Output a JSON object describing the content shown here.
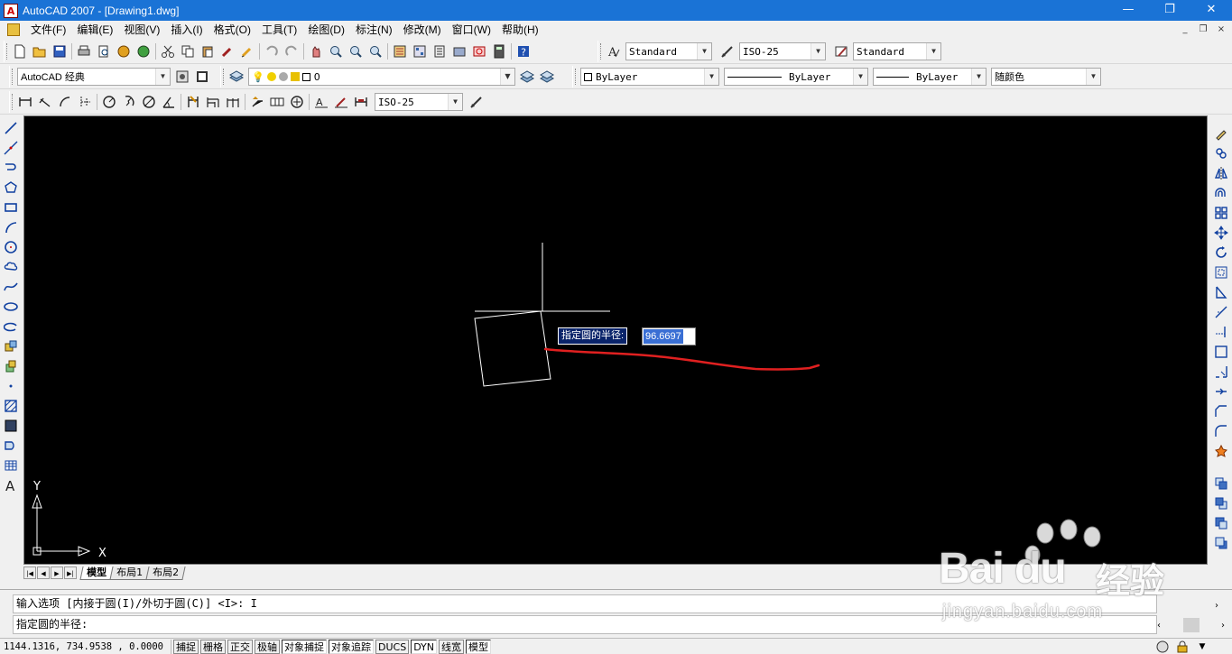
{
  "window": {
    "title": "AutoCAD 2007 - [Drawing1.dwg]",
    "controls": [
      "—",
      "❐",
      "✕"
    ],
    "mdi_controls": [
      "_",
      "❐",
      "×"
    ]
  },
  "menu": [
    "文件(F)",
    "编辑(E)",
    "视图(V)",
    "插入(I)",
    "格式(O)",
    "工具(T)",
    "绘图(D)",
    "标注(N)",
    "修改(M)",
    "窗口(W)",
    "帮助(H)"
  ],
  "toolbar_styles": {
    "text_style": "Standard",
    "dim_style": "ISO-25",
    "table_style": "Standard"
  },
  "toolbar_layers": {
    "workspace": "AutoCAD 经典",
    "layer": "0",
    "color": "ByLayer",
    "linetype": "ByLayer",
    "lineweight": "ByLayer",
    "plot_style": "随颜色"
  },
  "toolbar_dim": {
    "dim_style": "ISO-25"
  },
  "icons": {
    "standard_toolbar": [
      "new-icon",
      "open-icon",
      "save-icon",
      "print-icon",
      "preview-icon",
      "publish-icon",
      "3d-dwf-icon",
      "cut-icon",
      "copy-icon",
      "paste-icon",
      "match-properties-icon",
      "block-editor-icon",
      "undo-icon",
      "redo-icon",
      "pan-icon",
      "zoom-realtime-icon",
      "zoom-window-icon",
      "zoom-previous-icon",
      "properties-icon",
      "design-center-icon",
      "tool-palettes-icon",
      "sheet-set-icon",
      "markup-icon",
      "calculator-icon",
      "help-icon"
    ],
    "draw_toolbar": [
      "line-icon",
      "construction-line-icon",
      "polyline-icon",
      "polygon-icon",
      "rectangle-icon",
      "arc-icon",
      "circle-icon",
      "revision-cloud-icon",
      "spline-icon",
      "ellipse-icon",
      "ellipse-arc-icon",
      "insert-block-icon",
      "make-block-icon",
      "point-icon",
      "hatch-icon",
      "gradient-icon",
      "region-icon",
      "table-icon",
      "multiline-text-icon"
    ],
    "modify_toolbar": [
      "erase-icon",
      "copy-object-icon",
      "mirror-icon",
      "offset-icon",
      "array-icon",
      "move-icon",
      "rotate-icon",
      "scale-icon",
      "stretch-icon",
      "trim-icon",
      "extend-icon",
      "break-at-point-icon",
      "break-icon",
      "join-icon",
      "chamfer-icon",
      "fillet-icon",
      "explode-icon",
      "draworder-front-icon",
      "draworder-back-icon",
      "draworder-above-icon",
      "draworder-under-icon"
    ]
  },
  "drawing": {
    "tooltip_label": "指定圆的半径:",
    "tooltip_value": "96.6697",
    "ucs_x": "X",
    "ucs_y": "Y"
  },
  "layout_tabs": [
    "模型",
    "布局1",
    "布局2"
  ],
  "command": {
    "line1": "输入选项 [内接于圆(I)/外切于圆(C)] <I>: I",
    "line2": "指定圆的半径:"
  },
  "status": {
    "coords": "1144.1316, 734.9538 , 0.0000",
    "buttons": [
      {
        "label": "捕捉",
        "on": false
      },
      {
        "label": "栅格",
        "on": false
      },
      {
        "label": "正交",
        "on": false
      },
      {
        "label": "极轴",
        "on": false
      },
      {
        "label": "对象捕捉",
        "on": true
      },
      {
        "label": "对象追踪",
        "on": true
      },
      {
        "label": "DUCS",
        "on": false
      },
      {
        "label": "DYN",
        "on": true
      },
      {
        "label": "线宽",
        "on": false
      },
      {
        "label": "模型",
        "on": true
      }
    ]
  },
  "watermark": {
    "logo": "Bai du",
    "chinese": "经验",
    "url": "jingyan.baidu.com"
  },
  "colors": {
    "titlebar": "#1a73d6",
    "canvas": "#000000",
    "stroke_red": "#e02020",
    "dyn_label_bg": "#0a246a"
  }
}
